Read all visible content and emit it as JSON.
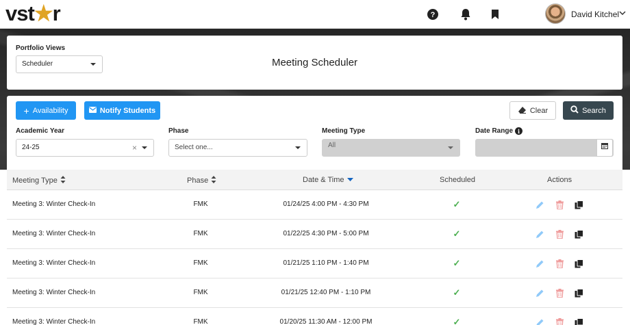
{
  "header": {
    "logo_text": "vstar",
    "user_name": "David Kitchel",
    "icons": [
      "help-icon",
      "bell-icon",
      "bookmark-icon",
      "avatar",
      "chevron-down-icon"
    ]
  },
  "portfolio": {
    "label": "Portfolio Views",
    "selected": "Scheduler",
    "page_title": "Meeting Scheduler"
  },
  "toolbar": {
    "availability_label": "Availability",
    "notify_label": "Notify Students",
    "clear_label": "Clear",
    "search_label": "Search"
  },
  "filters": {
    "academic_year": {
      "label": "Academic Year",
      "value": "24-25"
    },
    "phase": {
      "label": "Phase",
      "placeholder": "Select one..."
    },
    "meeting_type": {
      "label": "Meeting Type",
      "value": "All"
    },
    "date_range": {
      "label": "Date Range",
      "value": ""
    }
  },
  "table": {
    "columns": [
      "Meeting Type",
      "Phase",
      "Date & Time",
      "Scheduled",
      "Actions"
    ],
    "rows": [
      {
        "meeting_type": "Meeting 3: Winter Check-In",
        "phase": "FMK",
        "datetime": "01/24/25 4:00 PM - 4:30 PM",
        "scheduled": "✓"
      },
      {
        "meeting_type": "Meeting 3: Winter Check-In",
        "phase": "FMK",
        "datetime": "01/22/25 4:30 PM - 5:00 PM",
        "scheduled": "✓"
      },
      {
        "meeting_type": "Meeting 3: Winter Check-In",
        "phase": "FMK",
        "datetime": "01/21/25 1:10 PM - 1:40 PM",
        "scheduled": "✓"
      },
      {
        "meeting_type": "Meeting 3: Winter Check-In",
        "phase": "FMK",
        "datetime": "01/21/25 12:40 PM - 1:10 PM",
        "scheduled": "✓"
      },
      {
        "meeting_type": "Meeting 3: Winter Check-In",
        "phase": "FMK",
        "datetime": "01/20/25 11:30 AM - 12:00 PM",
        "scheduled": "✓"
      }
    ]
  },
  "colors": {
    "primary_blue": "#2196f3",
    "search_dark": "#37474f",
    "check_green": "#4caf50",
    "edit_blue": "#90caf9",
    "delete_red": "#ef9a9a",
    "sort_active": "#1565c0"
  }
}
